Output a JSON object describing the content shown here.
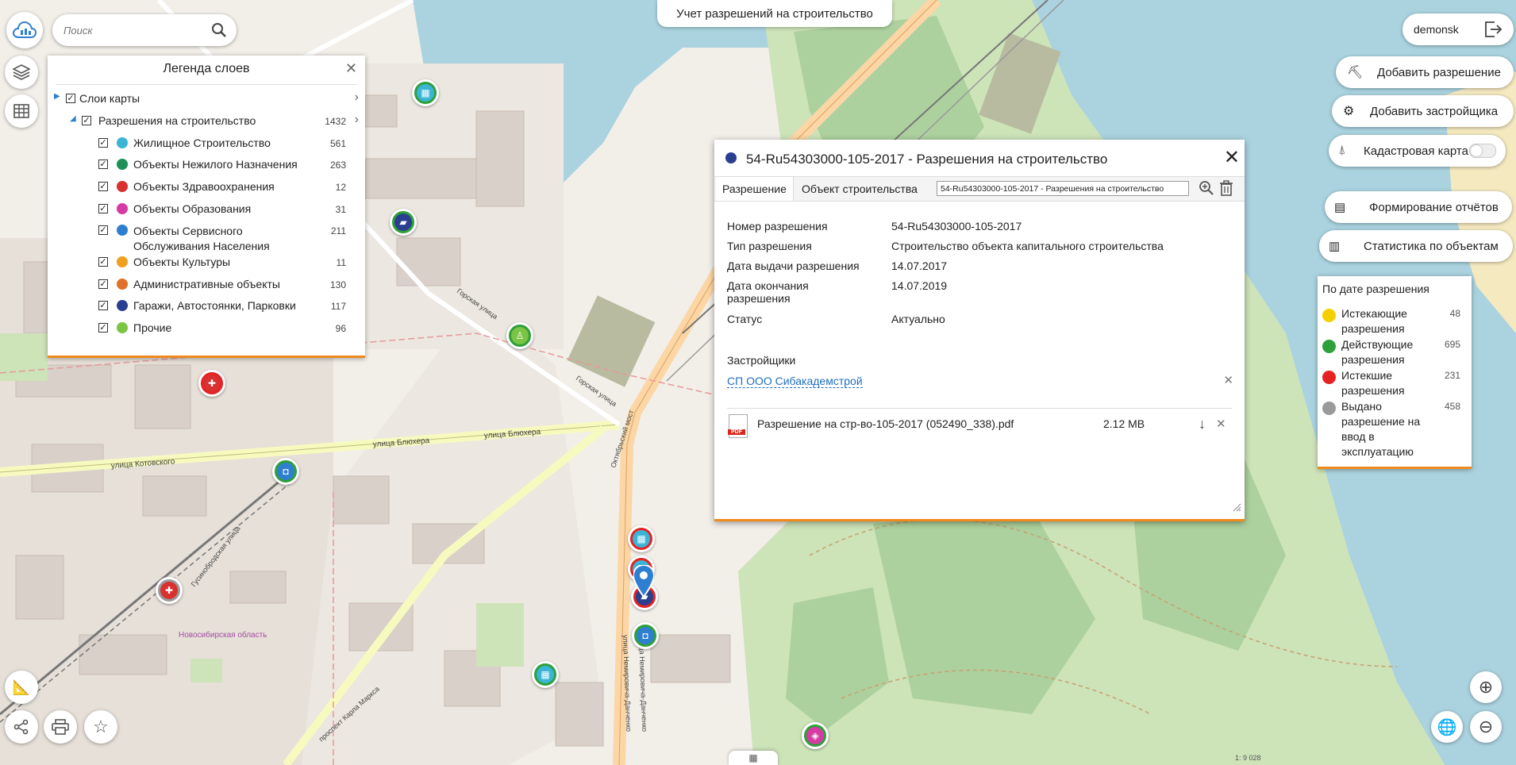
{
  "app": {
    "title": "Учет разрешений на строительство",
    "user": "demonsk"
  },
  "search": {
    "placeholder": "Поиск"
  },
  "right_buttons": {
    "add_permit": "Добавить разрешение",
    "add_developer": "Добавить застройщика",
    "cadastral_map": "Кадастровая карта",
    "reports": "Формирование отчётов",
    "statistics": "Статистика по объектам"
  },
  "legend": {
    "title": "Легенда слоев",
    "groups": [
      {
        "label": "Слои карты"
      },
      {
        "label": "Разрешения на строительство",
        "count": "1432"
      }
    ],
    "layers": [
      {
        "label": "Жилищное Строительство",
        "count": "561",
        "color": "#3ab5d6"
      },
      {
        "label": "Объекты Нежилого Назначения",
        "count": "263",
        "color": "#1f8f55"
      },
      {
        "label": "Объекты Здравоохранения",
        "count": "12",
        "color": "#d93030"
      },
      {
        "label": "Объекты Образования",
        "count": "31",
        "color": "#d63aa3"
      },
      {
        "label": "Объекты Сервисного Обслуживания Населения",
        "count": "211",
        "color": "#2f7fd1"
      },
      {
        "label": "Объекты Культуры",
        "count": "11",
        "color": "#f0a020"
      },
      {
        "label": "Административные объекты",
        "count": "130",
        "color": "#e0702a"
      },
      {
        "label": "Гаражи, Автостоянки, Парковки",
        "count": "117",
        "color": "#2a3f8f"
      },
      {
        "label": "Прочие",
        "count": "96",
        "color": "#7cc444"
      }
    ]
  },
  "popup": {
    "title": "54-Ru54303000-105-2017 - Разрешения на строительство",
    "tabs": [
      "Разрешение",
      "Объект строительства"
    ],
    "tab_field": "54-Ru54303000-105-2017 - Разрешения на строительство",
    "fields": [
      {
        "label": "Номер разрешения",
        "value": "54-Ru54303000-105-2017"
      },
      {
        "label": "Тип разрешения",
        "value": "Строительство объекта капитального строительства"
      },
      {
        "label": "Дата выдачи разрешения",
        "value": "14.07.2017"
      },
      {
        "label": "Дата окончания разрешения",
        "value": "14.07.2019"
      },
      {
        "label": "Статус",
        "value": "Актуально"
      }
    ],
    "developers_title": "Застройщики",
    "developer": "СП ООО Сибакадемстрой",
    "file": {
      "name": "Разрешение на стр-во-105-2017 (052490_338).pdf",
      "size": "2.12 MB",
      "icon_text": "PDF"
    }
  },
  "stats": {
    "title": "По дате разрешения",
    "items": [
      {
        "label": "Истекающие разрешения",
        "count": "48",
        "color": "#f5d000"
      },
      {
        "label": "Действующие разрешения",
        "count": "695",
        "color": "#2ea03a"
      },
      {
        "label": "Истекшие разрешения",
        "count": "231",
        "color": "#e52222"
      },
      {
        "label": "Выдано разрешение на ввод в эксплуатацию",
        "count": "458",
        "color": "#9a9a9a"
      }
    ]
  },
  "map_labels": {
    "street1": "улица Блюхера",
    "street2": "улица Котовского",
    "street3": "Горская улица",
    "street4": "Горская улица",
    "street5": "улица Немировича-Данченко",
    "street6": "улица Немировича-Данченко",
    "street7": "Октябрьский мост",
    "street8": "проспект Карла Маркса",
    "street9": "Гусинобродская улица",
    "region": "Новосибирская область",
    "scale": "1: 9 028"
  }
}
